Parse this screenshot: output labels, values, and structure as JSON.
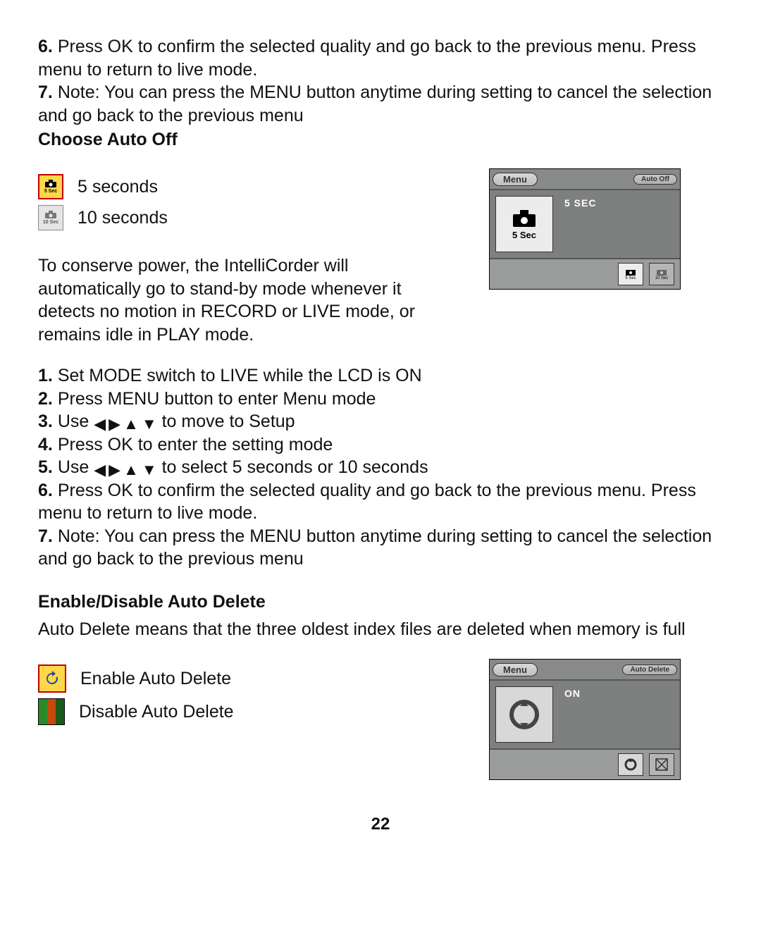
{
  "top": {
    "step6_num": "6.",
    "step6": "Press OK to confirm the selected quality and go back to the previous menu. Press menu to return to live mode.",
    "step7_num": "7.",
    "step7": "Note: You can press the MENU button anytime during setting to cancel the selection and go back to the previous menu"
  },
  "auto_off": {
    "heading": "Choose Auto Off",
    "opt5_label": "5 seconds",
    "opt5_icon_caption": "5 Sec",
    "opt10_label": "10 seconds",
    "opt10_icon_caption": "10 Sec",
    "desc": "To conserve power, the IntelliCorder will automatically go to stand-by mode whenever it detects no motion in RECORD or LIVE mode, or remains idle in PLAY mode.",
    "steps": {
      "n1": "1.",
      "t1": "Set MODE switch to LIVE while the LCD is ON",
      "n2": "2.",
      "t2": "Press MENU button to enter Menu mode",
      "n3": "3.",
      "t3_pre": "Use ",
      "t3_post": " to move to Setup",
      "n4": "4.",
      "t4": "Press OK to enter the setting mode",
      "n5": "5.",
      "t5_pre": "Use ",
      "t5_post": "  to select 5 seconds or 10 seconds",
      "n6": "6.",
      "t6": "Press OK to confirm the selected quality and go back to the previous menu. Press menu to return to live mode.",
      "n7": "7.",
      "t7": "Note: You can press the MENU button anytime during setting to cancel the selection and go back to the previous menu"
    },
    "device": {
      "menu": "Menu",
      "title": "Auto Off",
      "value": "5 SEC",
      "big_caption": "5 Sec",
      "mini1_cap": "5 Sec",
      "mini2_cap": "10 Sec"
    }
  },
  "auto_delete": {
    "heading": "Enable/Disable Auto Delete",
    "desc": "Auto Delete means that the three oldest index files are deleted when memory is full",
    "enable_label": "Enable Auto Delete",
    "disable_label": "Disable Auto Delete",
    "device": {
      "menu": "Menu",
      "title": "Auto Delete",
      "value": "ON"
    }
  },
  "arrows": {
    "left": "◀",
    "right": "▶",
    "up": "▲",
    "down": "▼"
  },
  "page_number": "22"
}
